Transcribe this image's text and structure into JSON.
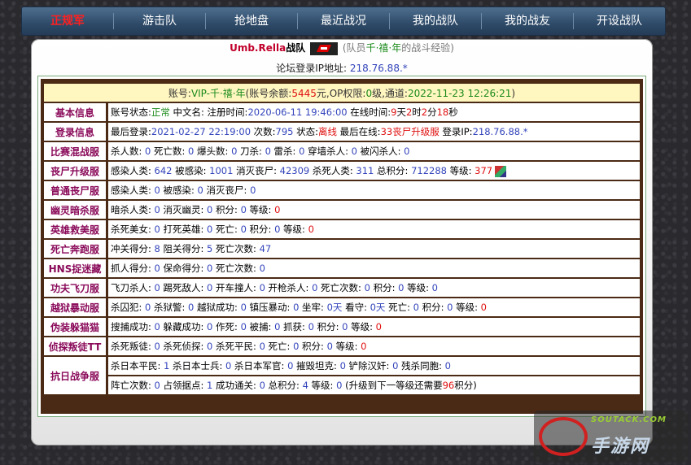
{
  "nav": [
    {
      "label": "正规军",
      "active": true
    },
    {
      "label": "游击队"
    },
    {
      "label": "抢地盘"
    },
    {
      "label": "最近战况"
    },
    {
      "label": "我的战队"
    },
    {
      "label": "我的战友"
    },
    {
      "label": "开设战队"
    }
  ],
  "title": {
    "team_name": "Umb.Rella",
    "team_word": "战队",
    "member_prefix": "(队员",
    "member_name": "千·禧·年",
    "member_suffix": "的战斗经验)"
  },
  "ip": {
    "label": "论坛登录IP地址:",
    "value": "218.76.88.*"
  },
  "account": {
    "l1": "账号:",
    "name": "VIP-千·禧·年",
    "l2": "(账号余额:",
    "balance": "5445",
    "l3": "元,OP权限:",
    "op": "0",
    "l4": "级,通道:",
    "time": "2022-11-23 12:26:21",
    "l5": ")"
  },
  "rows": {
    "basic": {
      "label": "基本信息",
      "t1": "账号状态:",
      "status": "正常",
      "t2": " 中文名: 注册时间:",
      "reg": "2020-06-11 19:46:00",
      "t3": " 在线时间:",
      "d": "9",
      "du": "天",
      "h": "2",
      "hu": "时",
      "m": "2",
      "mu": "分",
      "s": "18",
      "su": "秒"
    },
    "login": {
      "label": "登录信息",
      "t1": "最后登录:",
      "last": "2021-02-27 22:19:00",
      "t2": " 次数:",
      "count": "795",
      "t3": " 状态:",
      "state": "离线",
      "t4": " 最后在线:",
      "server": "33丧尸升级服",
      "t5": " 登录IP:",
      "ip": "218.76.88.*"
    },
    "match": {
      "label": "比赛混战服",
      "text": "杀人数: ",
      "v1": "0",
      "t2": " 死亡数: ",
      "v2": "0",
      "t3": " 爆头数: ",
      "v3": "0",
      "t4": " 刀杀: ",
      "v4": "0",
      "t5": " 雷杀: ",
      "v5": "0",
      "t6": " 穿墙杀人: ",
      "v6": "0",
      "t7": " 被闪杀人: ",
      "v7": "0"
    },
    "zombie_up": {
      "label": "丧尸升级服",
      "t1": "感染人类: ",
      "v1": "642",
      "t2": " 被感染: ",
      "v2": "1001",
      "t3": " 消灭丧尸: ",
      "v3": "42309",
      "t4": " 杀死人类: ",
      "v4": "311",
      "t5": " 总积分: ",
      "v5": "712288",
      "t6": " 等级: ",
      "v6": "377"
    },
    "zombie": {
      "label": "普通丧尸服",
      "t1": "感染人类: ",
      "v1": "0",
      "t2": " 被感染: ",
      "v2": "0",
      "t3": " 消灭丧尸: ",
      "v3": "0"
    },
    "ghost": {
      "label": "幽灵暗杀服",
      "t1": "暗杀人类: ",
      "v1": "0",
      "t2": " 消灭幽灵: ",
      "v2": "0",
      "t3": " 积分: ",
      "v3": "0",
      "t4": " 等级: ",
      "v4": "0"
    },
    "hero": {
      "label": "英雄救美服",
      "t1": "杀死美女: ",
      "v1": "0",
      "t2": " 打死英雄: ",
      "v2": "0",
      "t3": " 死亡: ",
      "v3": "0",
      "t4": " 积分: ",
      "v4": "0",
      "t5": " 等级: ",
      "v5": "0"
    },
    "death_run": {
      "label": "死亡奔跑服",
      "t1": "冲关得分: ",
      "v1": "8",
      "t2": " 阻关得分: ",
      "v2": "5",
      "t3": " 死亡次数: ",
      "v3": "47"
    },
    "hns": {
      "label": "HNS捉迷藏",
      "t1": "抓人得分: ",
      "v1": "0",
      "t2": " 保命得分: ",
      "v2": "0",
      "t3": " 死亡次数: ",
      "v3": "0"
    },
    "kungfu": {
      "label": "功夫飞刀服",
      "t1": "飞刀杀人: ",
      "v1": "0",
      "t2": " 踢死敌人: ",
      "v2": "0",
      "t3": " 开车撞人: ",
      "v3": "0",
      "t4": " 开枪杀人: ",
      "v4": "0",
      "t5": " 死亡次数: ",
      "v5": "0",
      "t6": " 积分: ",
      "v6": "0",
      "t7": " 等级: ",
      "v7": "0"
    },
    "jail": {
      "label": "越狱暴动服",
      "t1": "杀囚犯: ",
      "v1": "0",
      "t2": " 杀狱警: ",
      "v2": "0",
      "t3": " 越狱成功: ",
      "v3": "0",
      "t4": " 镇压暴动: ",
      "v4": "0",
      "t5": " 坐牢: ",
      "v5": "0天",
      "t6": " 看守: ",
      "v6": "0天",
      "t7": " 死亡: ",
      "v7": "0",
      "t8": " 积分: ",
      "v8": "0",
      "t9": " 等级: ",
      "v9": "0"
    },
    "hide": {
      "label": "伪装躲猫猫",
      "t1": "搜捕成功: ",
      "v1": "0",
      "t2": " 躲藏成功: ",
      "v2": "0",
      "t3": " 作死: ",
      "v3": "0",
      "t4": " 被捕: ",
      "v4": "0",
      "t5": " 抓获: ",
      "v5": "0",
      "t6": " 积分: ",
      "v6": "0",
      "t7": " 等级: ",
      "v7": "0"
    },
    "detect": {
      "label": "侦探叛徒TT",
      "t1": "杀死叛徒: ",
      "v1": "0",
      "t2": " 杀死侦探: ",
      "v2": "0",
      "t3": " 杀死平民: ",
      "v3": "0",
      "t4": " 死亡: ",
      "v4": "0",
      "t5": " 积分: ",
      "v5": "0",
      "t6": " 等级: ",
      "v6": "0"
    },
    "war": {
      "label": "抗日战争服",
      "a1": "杀日本平民: ",
      "av1": "1",
      "a2": " 杀日本士兵: ",
      "av2": "0",
      "a3": " 杀日本军官: ",
      "av3": "0",
      "a4": " 摧毁坦克: ",
      "av4": "0",
      "a5": " 铲除汉奸: ",
      "av5": "0",
      "a6": " 残杀同胞: ",
      "av6": "0",
      "b1": "阵亡次数: ",
      "bv1": "0",
      "b2": " 占领据点: ",
      "bv2": "1",
      "b3": " 成功通关: ",
      "bv3": "0",
      "b4": " 总积分: ",
      "bv4": "4",
      "b5": " 等级: ",
      "bv5": "0",
      "b6": " (升级到下一等级还需要",
      "bv6": "96",
      "b7": "积分)"
    }
  },
  "watermark": {
    "line1": "SOUTACK.COM",
    "line2": "手游网"
  },
  "icons": {
    "team": "team-emblem-icon",
    "avatar": "level-avatar-icon"
  }
}
